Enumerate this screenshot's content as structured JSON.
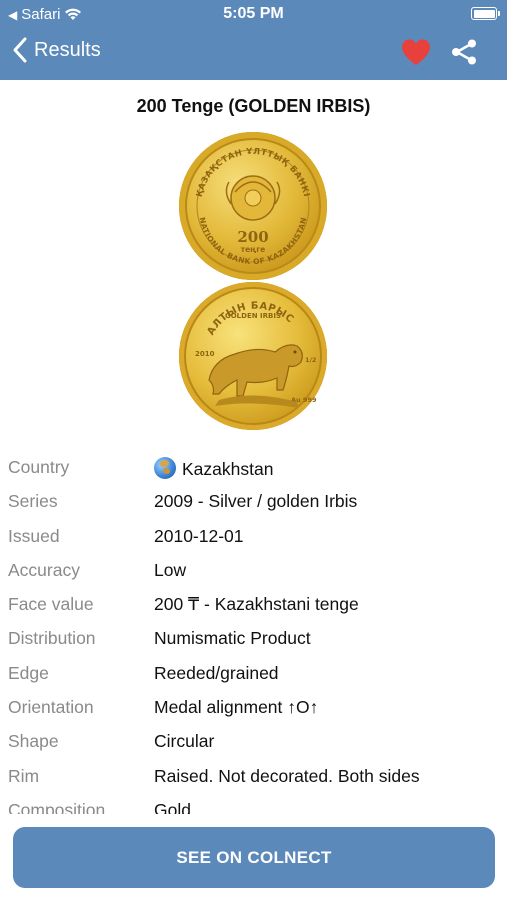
{
  "status_bar": {
    "carrier": "Safari",
    "time": "5:05 PM"
  },
  "nav": {
    "back_label": "Results",
    "favorite_color": "#e8413b",
    "bar_color": "#5b89ba"
  },
  "coin": {
    "title": "200 Tenge (GOLDEN IRBIS)",
    "obverse_text_top": "ҚАЗАҚСТАН ҰЛТТЫҚ БАНКІ",
    "obverse_text_bottom": "NATIONAL BANK OF KAZAKHSTAN",
    "obverse_value": "200",
    "obverse_unit": "теңге",
    "reverse_text_top": "АЛТЫН БАРЫС",
    "reverse_text_sub": "GOLDEN IRBIS",
    "reverse_year": "2010",
    "reverse_mark": "Au 999",
    "reverse_weight": "1/2"
  },
  "details": [
    {
      "label": "Country",
      "value": "Kazakhstan",
      "icon": "globe-icon"
    },
    {
      "label": "Series",
      "value": "2009 - Silver / golden Irbis"
    },
    {
      "label": "Issued",
      "value": "2010-12-01"
    },
    {
      "label": "Accuracy",
      "value": "Low"
    },
    {
      "label": "Face value",
      "value": "200 ₸ - Kazakhstani tenge"
    },
    {
      "label": "Distribution",
      "value": "Numismatic Product"
    },
    {
      "label": "Edge",
      "value": "Reeded/grained"
    },
    {
      "label": "Orientation",
      "value": "Medal alignment ↑O↑"
    },
    {
      "label": "Shape",
      "value": "Circular"
    },
    {
      "label": "Rim",
      "value": "Raised. Not decorated. Both sides"
    },
    {
      "label": "Composition",
      "value": "Gold"
    }
  ],
  "cta": {
    "label": "SEE ON COLNECT"
  }
}
